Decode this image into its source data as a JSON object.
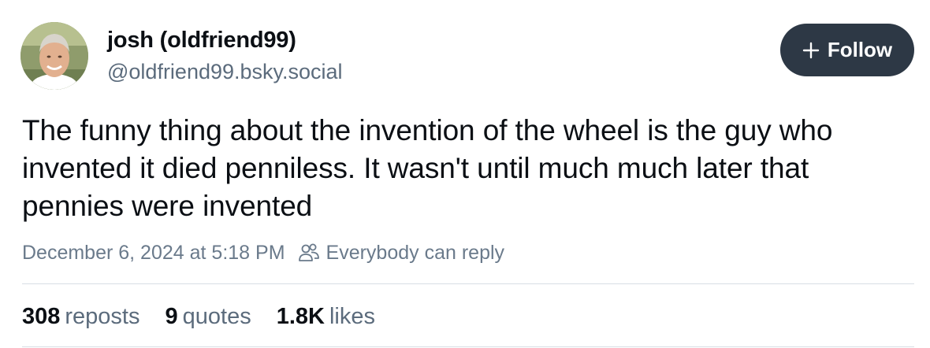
{
  "author": {
    "display_name": "josh (oldfriend99)",
    "handle": "@oldfriend99.bsky.social",
    "avatar_icon": "avatar-photo"
  },
  "follow_button": {
    "label": "Follow",
    "icon": "plus-icon",
    "background": "#2d3845"
  },
  "post": {
    "text": "The funny thing about the invention of the wheel is the guy who invented it died penniless. It wasn't until much much later that pennies were invented",
    "timestamp": "December 6, 2024 at 5:18 PM",
    "reply_setting_icon": "people-icon",
    "reply_setting": "Everybody can reply"
  },
  "stats": {
    "reposts_count": "308",
    "reposts_label": "reposts",
    "quotes_count": "9",
    "quotes_label": "quotes",
    "likes_count": "1.8K",
    "likes_label": "likes"
  }
}
